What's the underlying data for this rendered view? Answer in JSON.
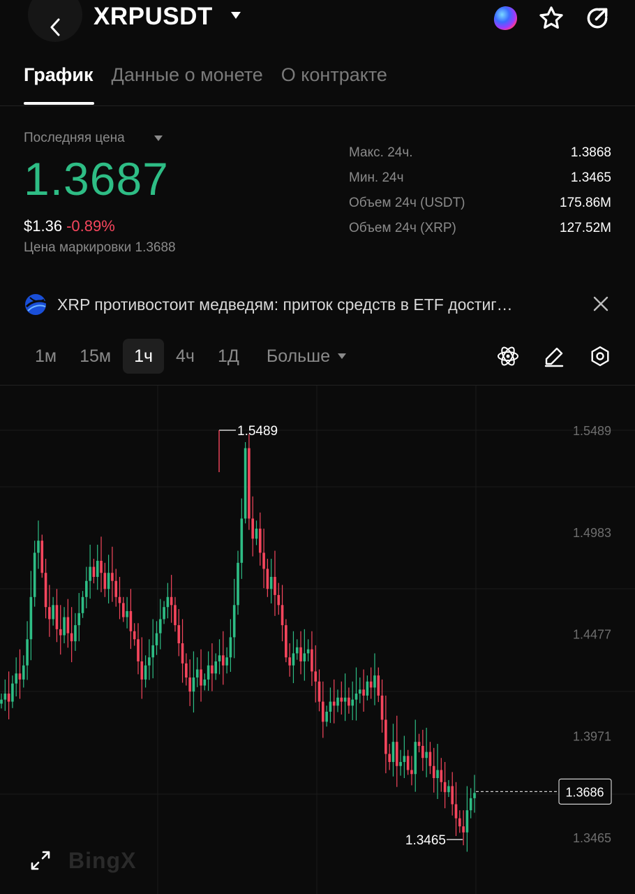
{
  "header": {
    "pair": "XRPUSDT",
    "icons": [
      "back-chevron-icon",
      "caret-down-icon",
      "ai-orb-icon",
      "star-icon",
      "share-icon"
    ]
  },
  "tabs": [
    {
      "label": "График",
      "active": true
    },
    {
      "label": "Данные о монете",
      "active": false
    },
    {
      "label": "О контракте",
      "active": false
    }
  ],
  "price": {
    "label": "Последняя цена",
    "last": "1.3687",
    "usd": "$1.36",
    "change": "-0.89%",
    "mark": "Цена маркировки 1.3688",
    "colors": {
      "up": "#2ebd85",
      "down": "#f6465d"
    }
  },
  "stats": [
    {
      "label": "Макс. 24ч.",
      "value": "1.3868"
    },
    {
      "label": "Мин. 24ч",
      "value": "1.3465"
    },
    {
      "label": "Объем 24ч (USDT)",
      "value": "175.86M"
    },
    {
      "label": "Объем 24ч (XRP)",
      "value": "127.52M"
    }
  ],
  "news": {
    "text": "XRP противостоит медведям: приток средств в ETF достиг…",
    "icon": "globe-icon"
  },
  "timeframes": {
    "items": [
      "1м",
      "15м",
      "1ч",
      "4ч",
      "1Д"
    ],
    "active": "1ч",
    "more": "Больше"
  },
  "toolbar_icons": [
    "indicators-atom-icon",
    "draw-pen-icon",
    "settings-hexagon-icon"
  ],
  "chart_data": {
    "type": "candlestick",
    "y_ticks": [
      "1.5489",
      "1.4983",
      "1.4477",
      "1.3971",
      "1.3465"
    ],
    "ylim": [
      1.3465,
      1.5489
    ],
    "high_label": "1.5489",
    "low_label": "1.3465",
    "current_price_label": "1.3686",
    "current_price": 1.3686,
    "grid": true,
    "colors": {
      "up": "#2ebd85",
      "down": "#f6465d"
    },
    "series_close": [
      1.415,
      1.418,
      1.414,
      1.423,
      1.428,
      1.425,
      1.432,
      1.445,
      1.466,
      1.488,
      1.494,
      1.478,
      1.461,
      1.455,
      1.462,
      1.45,
      1.447,
      1.456,
      1.448,
      1.444,
      1.452,
      1.458,
      1.466,
      1.474,
      1.481,
      1.476,
      1.484,
      1.478,
      1.47,
      1.478,
      1.474,
      1.466,
      1.463,
      1.456,
      1.459,
      1.449,
      1.445,
      1.434,
      1.425,
      1.432,
      1.436,
      1.442,
      1.448,
      1.455,
      1.461,
      1.466,
      1.462,
      1.452,
      1.443,
      1.433,
      1.426,
      1.419,
      1.426,
      1.43,
      1.422,
      1.425,
      1.432,
      1.428,
      1.434,
      1.437,
      1.432,
      1.436,
      1.446,
      1.462,
      1.483,
      1.505,
      1.54,
      1.505,
      1.495,
      1.5,
      1.488,
      1.48,
      1.47,
      1.476,
      1.467,
      1.462,
      1.452,
      1.436,
      1.432,
      1.438,
      1.441,
      1.434,
      1.438,
      1.44,
      1.429,
      1.424,
      1.414,
      1.404,
      1.409,
      1.414,
      1.412,
      1.416,
      1.414,
      1.416,
      1.412,
      1.415,
      1.418,
      1.42,
      1.417,
      1.424,
      1.421,
      1.427,
      1.417,
      1.405,
      1.388,
      1.384,
      1.394,
      1.382,
      1.384,
      1.387,
      1.38,
      1.378,
      1.394,
      1.392,
      1.386,
      1.389,
      1.382,
      1.376,
      1.38,
      1.374,
      1.369,
      1.372,
      1.363,
      1.356,
      1.352,
      1.349,
      1.36,
      1.366,
      1.3686
    ]
  }
}
